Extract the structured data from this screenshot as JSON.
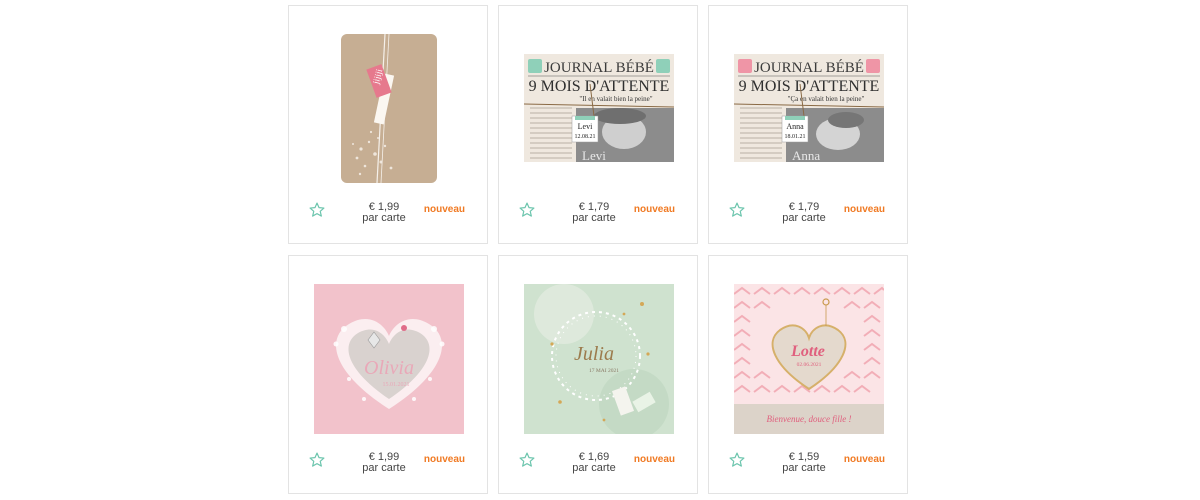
{
  "accent_color": "#f07a23",
  "star_color": "#6cc5ad",
  "products": [
    {
      "price": "€ 1,99",
      "unit": "par carte",
      "badge": "nouveau",
      "image": "kraft-card-pink-tag-icon"
    },
    {
      "price": "€ 1,79",
      "unit": "par carte",
      "badge": "nouveau",
      "image": "newspaper-card-levi-icon",
      "texts": {
        "masthead": "JOURNAL BÉBÉ",
        "headline": "9 MOIS D'ATTENTE",
        "quote": "\"Il en valait bien la peine\"",
        "name": "Levi",
        "date": "12.08.21",
        "photo_name": "Levi"
      }
    },
    {
      "price": "€ 1,79",
      "unit": "par carte",
      "badge": "nouveau",
      "image": "newspaper-card-anna-icon",
      "texts": {
        "masthead": "JOURNAL BÉBÉ",
        "headline": "9 MOIS D'ATTENTE",
        "quote": "\"Ça en valait bien la peine\"",
        "name": "Anna",
        "date": "18.01.21",
        "photo_name": "Anna"
      }
    },
    {
      "price": "€ 1,99",
      "unit": "par carte",
      "badge": "nouveau",
      "image": "pink-heart-card-olivia-icon",
      "texts": {
        "name": "Olivia",
        "date": "15.01.2021"
      }
    },
    {
      "price": "€ 1,69",
      "unit": "par carte",
      "badge": "nouveau",
      "image": "green-wreath-card-julia-icon",
      "texts": {
        "name": "Julia",
        "date": "17 MAI 2021"
      }
    },
    {
      "price": "€ 1,59",
      "unit": "par carte",
      "badge": "nouveau",
      "image": "heart-card-lotte-icon",
      "texts": {
        "name": "Lotte",
        "date": "02.06.2021",
        "banner": "Bienvenue, douce fille !"
      }
    }
  ]
}
